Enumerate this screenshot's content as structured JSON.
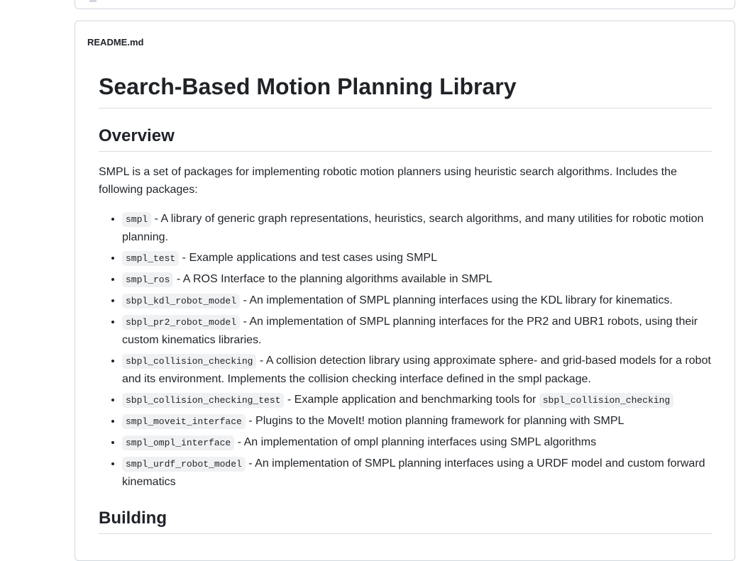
{
  "readme": {
    "filename": "README.md",
    "title": "Search-Based Motion Planning Library",
    "overview_heading": "Overview",
    "overview_text": "SMPL is a set of packages for implementing robotic motion planners using heuristic search algorithms. Includes the following packages:",
    "packages": [
      {
        "code": "smpl",
        "desc": " - A library of generic graph representations, heuristics, search algorithms, and many utilities for robotic motion planning."
      },
      {
        "code": "smpl_test",
        "desc": " - Example applications and test cases using SMPL"
      },
      {
        "code": "smpl_ros",
        "desc": " - A ROS Interface to the planning algorithms available in SMPL"
      },
      {
        "code": "sbpl_kdl_robot_model",
        "desc": " - An implementation of SMPL planning interfaces using the KDL library for kinematics."
      },
      {
        "code": "sbpl_pr2_robot_model",
        "desc": " - An implementation of SMPL planning interfaces for the PR2 and UBR1 robots, using their custom kinematics libraries."
      },
      {
        "code": "sbpl_collision_checking",
        "desc": " - A collision detection library using approximate sphere- and grid-based models for a robot and its environment. Implements the collision checking interface defined in the smpl package."
      },
      {
        "code": "sbpl_collision_checking_test",
        "desc": " - Example application and benchmarking tools for ",
        "code2": "sbpl_collision_checking"
      },
      {
        "code": "smpl_moveit_interface",
        "desc": " - Plugins to the MoveIt! motion planning framework for planning with SMPL"
      },
      {
        "code": "smpl_ompl_interface",
        "desc": " - An implementation of ompl planning interfaces using SMPL algorithms"
      },
      {
        "code": "smpl_urdf_robot_model",
        "desc": " - An implementation of SMPL planning interfaces using a URDF model and custom forward kinematics"
      }
    ],
    "building_heading": "Building"
  }
}
